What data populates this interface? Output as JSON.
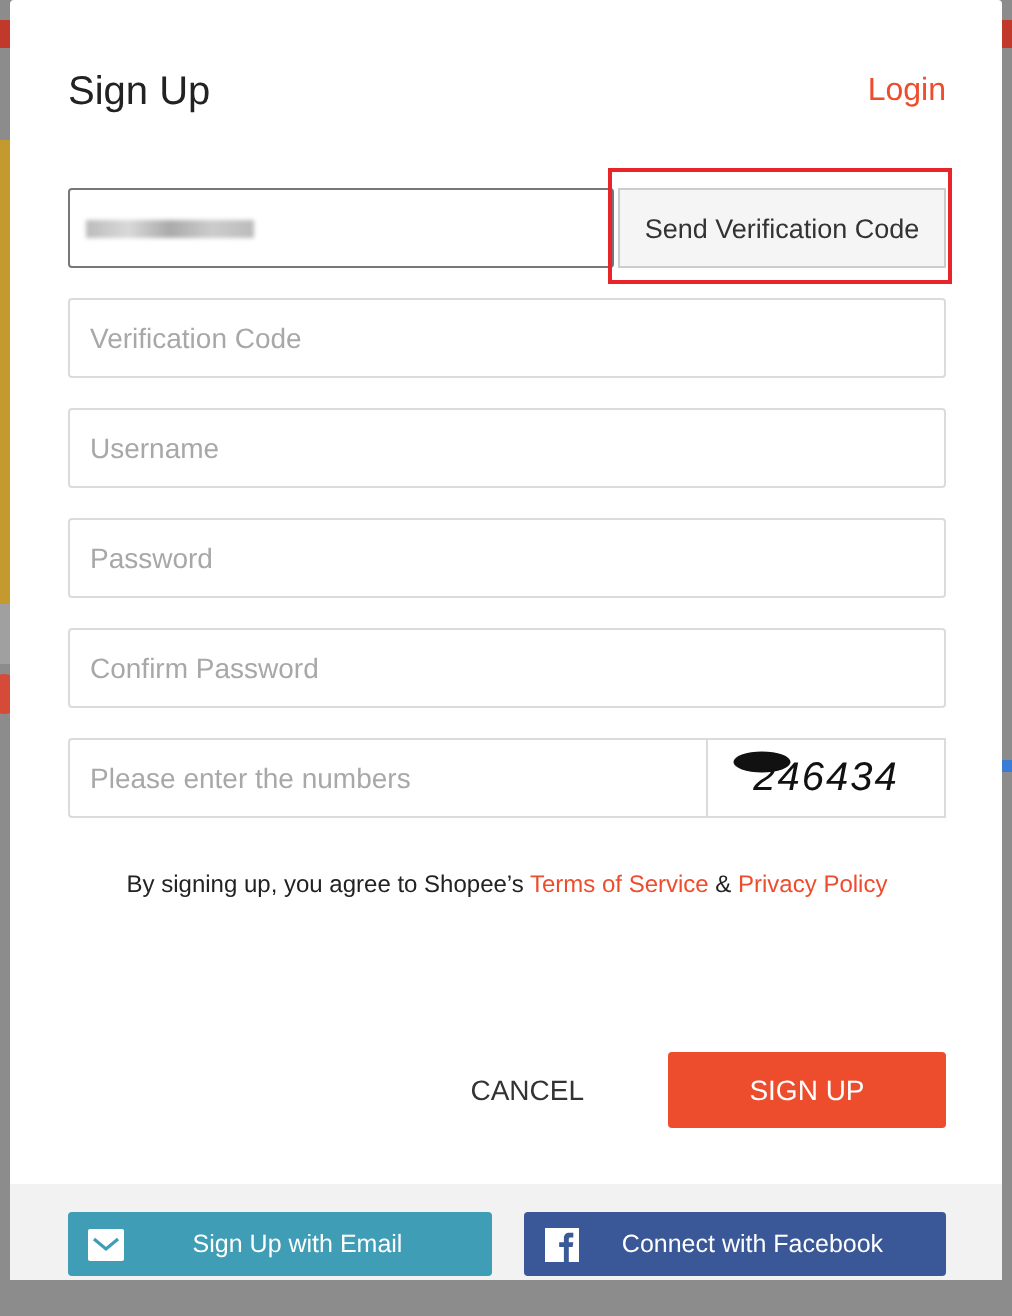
{
  "dialog": {
    "title": "Sign Up",
    "login_link": "Login"
  },
  "phone_field": {
    "redacted": true
  },
  "send_code_button": {
    "label": "Send Verification Code",
    "highlighted": true
  },
  "fields": [
    {
      "placeholder": "Verification Code"
    },
    {
      "placeholder": "Username"
    },
    {
      "placeholder": "Password"
    },
    {
      "placeholder": "Confirm Password"
    }
  ],
  "captcha": {
    "placeholder": "Please enter the numbers",
    "code": "246434"
  },
  "terms": {
    "before": "By signing up, you agree to Shopee’s",
    "terms_link": "Terms of Service",
    "joiner": "&",
    "privacy_link": "Privacy Policy"
  },
  "actions": {
    "cancel": "CANCEL",
    "submit": "SIGN UP"
  },
  "social": [
    {
      "label": "Sign Up with Email",
      "kind": "email"
    },
    {
      "label": "Connect with Facebook",
      "kind": "facebook"
    }
  ]
}
